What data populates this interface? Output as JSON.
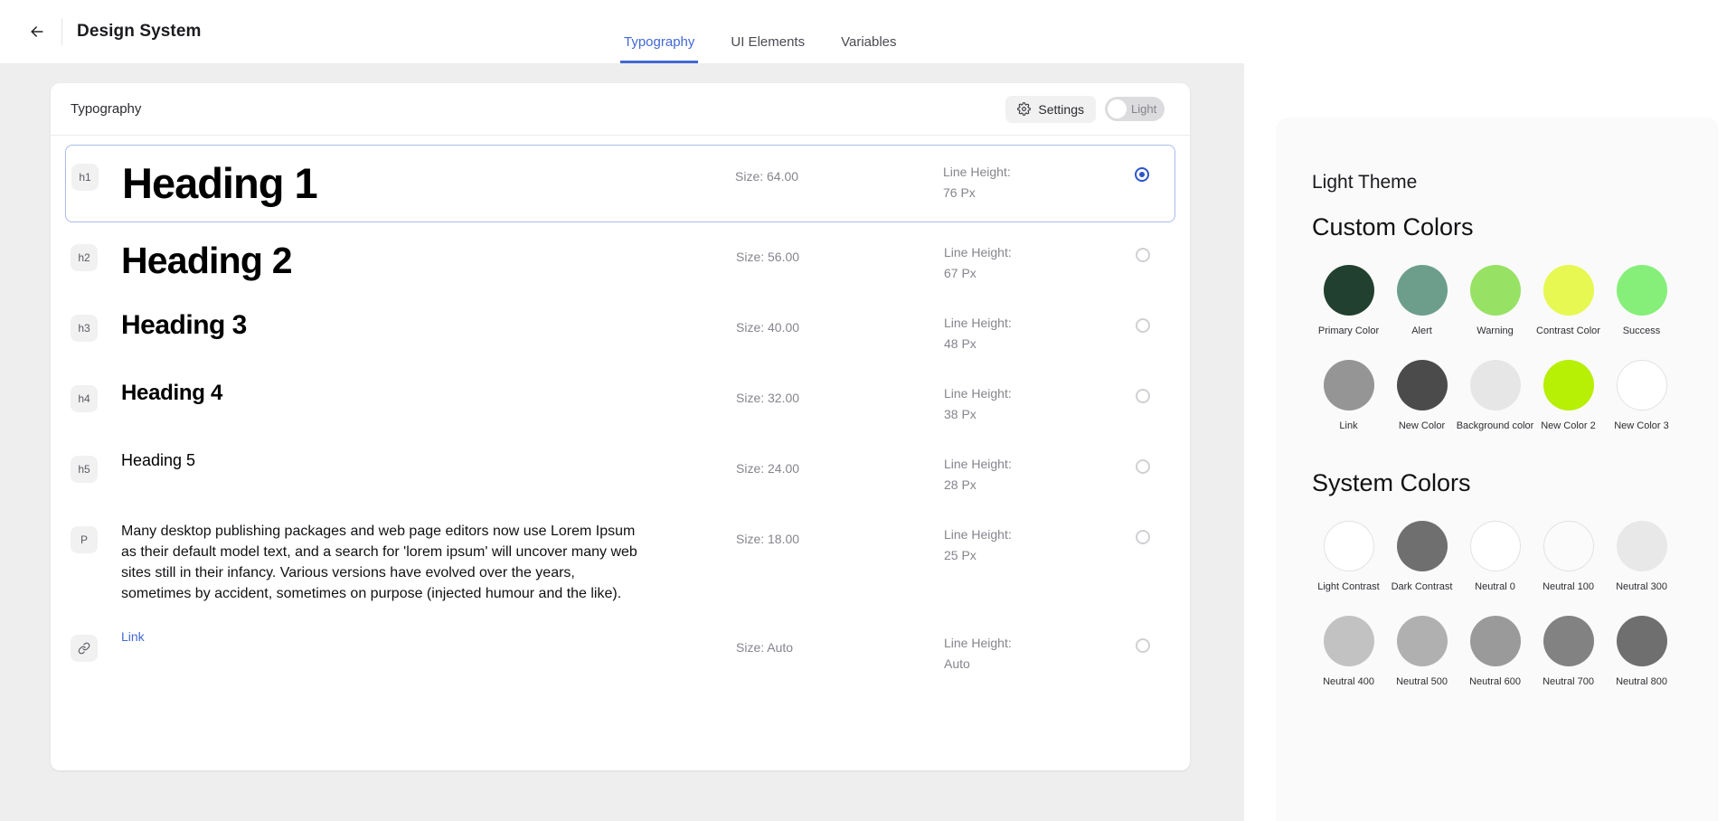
{
  "header": {
    "back_icon": "arrow-left-icon",
    "title": "Design System",
    "tabs": [
      {
        "label": "Typography",
        "active": true
      },
      {
        "label": "UI Elements",
        "active": false
      },
      {
        "label": "Variables",
        "active": false
      }
    ]
  },
  "card": {
    "title": "Typography",
    "settings_label": "Settings",
    "settings_icon": "gear-icon",
    "theme_toggle_label": "Light",
    "theme_toggle_on": false
  },
  "typography_rows": [
    {
      "badge": "h1",
      "sample": "Heading 1",
      "tag": "h1",
      "size": "Size: 64.00",
      "line_height_label": "Line Height:",
      "line_height_value": "76 Px",
      "selected": true
    },
    {
      "badge": "h2",
      "sample": "Heading 2",
      "tag": "h2",
      "size": "Size: 56.00",
      "line_height_label": "Line Height:",
      "line_height_value": "67 Px",
      "selected": false
    },
    {
      "badge": "h3",
      "sample": "Heading 3",
      "tag": "h3",
      "size": "Size: 40.00",
      "line_height_label": "Line Height:",
      "line_height_value": "48 Px",
      "selected": false
    },
    {
      "badge": "h4",
      "sample": "Heading 4",
      "tag": "h4",
      "size": "Size: 32.00",
      "line_height_label": "Line Height:",
      "line_height_value": "38 Px",
      "selected": false
    },
    {
      "badge": "h5",
      "sample": "Heading 5",
      "tag": "h5",
      "size": "Size: 24.00",
      "line_height_label": "Line Height:",
      "line_height_value": "28 Px",
      "selected": false
    },
    {
      "badge": "P",
      "tag": "p",
      "sample": "Many desktop publishing packages and web page editors now use Lorem Ipsum as their default model text, and a search for 'lorem ipsum' will uncover many web sites still in their infancy. Various versions have evolved over the years, sometimes by accident, sometimes on purpose (injected humour and the like).",
      "size": "Size: 18.00",
      "line_height_label": "Line Height:",
      "line_height_value": "25 Px",
      "selected": false
    },
    {
      "badge": "link-icon",
      "tag": "link",
      "sample": "Link",
      "size": "Size: Auto",
      "line_height_label": "Line Height:",
      "line_height_value": "Auto",
      "selected": false
    }
  ],
  "theme_panel": {
    "theme_name": "Light Theme",
    "custom_colors_title": "Custom Colors",
    "system_colors_title": "System Colors",
    "custom_colors": [
      {
        "label": "Primary Color",
        "hex": "#21402f",
        "bordered": false
      },
      {
        "label": "Alert",
        "hex": "#6d9e8c",
        "bordered": false
      },
      {
        "label": "Warning",
        "hex": "#97e264",
        "bordered": false
      },
      {
        "label": "Contrast Color",
        "hex": "#e6f851",
        "bordered": false
      },
      {
        "label": "Success",
        "hex": "#85ef79",
        "bordered": false
      },
      {
        "label": "Link",
        "hex": "#959595",
        "bordered": false
      },
      {
        "label": "New Color",
        "hex": "#4b4b4b",
        "bordered": false
      },
      {
        "label": "Background color",
        "hex": "#e6e6e6",
        "bordered": false
      },
      {
        "label": "New Color 2",
        "hex": "#b7ef05",
        "bordered": false
      },
      {
        "label": "New Color 3",
        "hex": "#ffffff",
        "bordered": true
      }
    ],
    "system_colors": [
      {
        "label": "Light Contrast",
        "hex": "#ffffff",
        "bordered": true
      },
      {
        "label": "Dark Contrast",
        "hex": "#6f6f6f",
        "bordered": false
      },
      {
        "label": "Neutral 0",
        "hex": "#ffffff",
        "bordered": true
      },
      {
        "label": "Neutral 100",
        "hex": "#fbfbfb",
        "bordered": true
      },
      {
        "label": "Neutral 300",
        "hex": "#e8e8e8",
        "bordered": false
      },
      {
        "label": "Neutral 400",
        "hex": "#c2c2c2",
        "bordered": false
      },
      {
        "label": "Neutral 500",
        "hex": "#b0b0b0",
        "bordered": false
      },
      {
        "label": "Neutral 600",
        "hex": "#9a9a9a",
        "bordered": false
      },
      {
        "label": "Neutral 700",
        "hex": "#828282",
        "bordered": false
      },
      {
        "label": "Neutral 800",
        "hex": "#6f6f6f",
        "bordered": false
      }
    ]
  },
  "colors": {
    "accent_blue": "#4268d4",
    "radio_blue": "#2b55c9",
    "canvas_bg": "#eeeeee",
    "panel_bg": "#fafafa"
  }
}
